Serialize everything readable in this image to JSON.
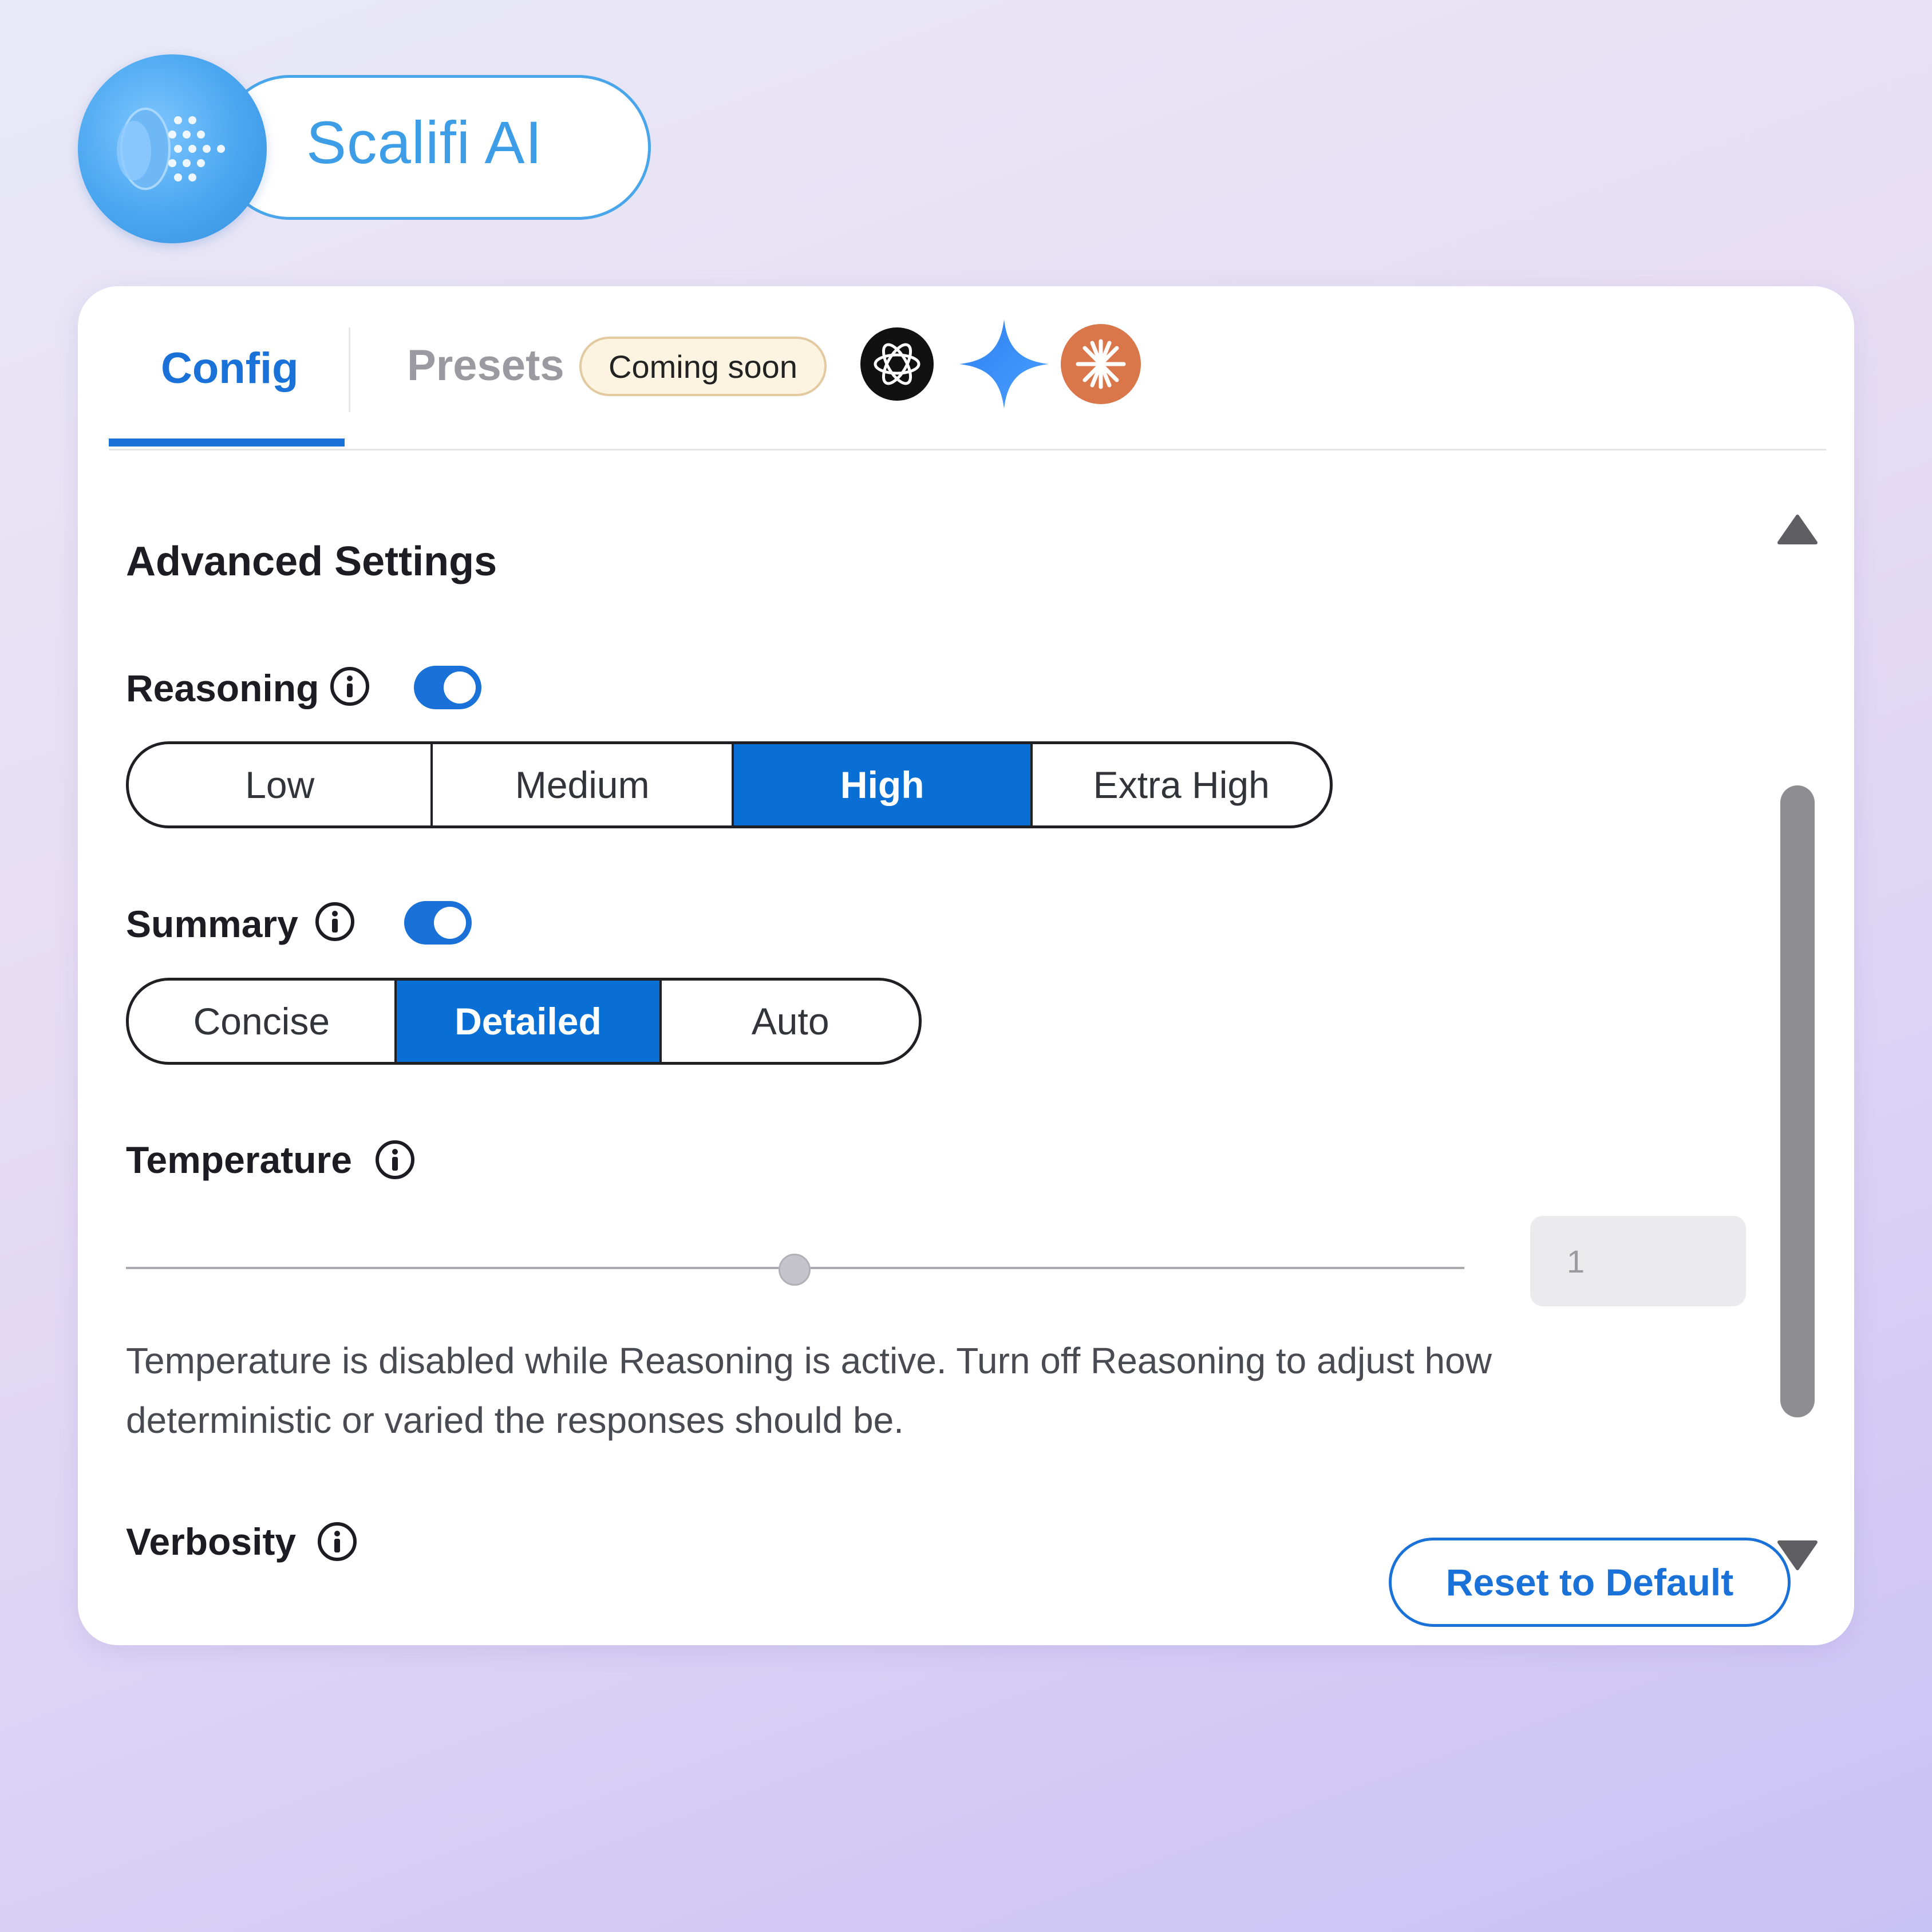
{
  "brand": {
    "name": "Scalifi AI"
  },
  "tabs": [
    {
      "label": "Config",
      "active": true
    },
    {
      "label": "Presets",
      "active": false,
      "badge": "Coming soon"
    }
  ],
  "provider_icons": [
    "openai-icon",
    "gemini-icon",
    "claude-icon"
  ],
  "settings": {
    "title": "Advanced Settings",
    "reasoning": {
      "label": "Reasoning",
      "enabled": true,
      "options": [
        "Low",
        "Medium",
        "High",
        "Extra High"
      ],
      "selected": "High"
    },
    "summary": {
      "label": "Summary",
      "enabled": true,
      "options": [
        "Concise",
        "Detailed",
        "Auto"
      ],
      "selected": "Detailed"
    },
    "temperature": {
      "label": "Temperature",
      "value": "1",
      "slider_fraction": 0.5,
      "help": "Temperature is disabled while Reasoning is active. Turn off Reasoning to adjust how deterministic or varied the responses should be."
    },
    "verbosity": {
      "label": "Verbosity"
    }
  },
  "actions": {
    "reset_label": "Reset to Default"
  },
  "colors": {
    "accent": "#1a72d9",
    "active_segment": "#0a6fd4",
    "brand": "#3d9de6",
    "badge_bg": "#fdf3e1"
  }
}
